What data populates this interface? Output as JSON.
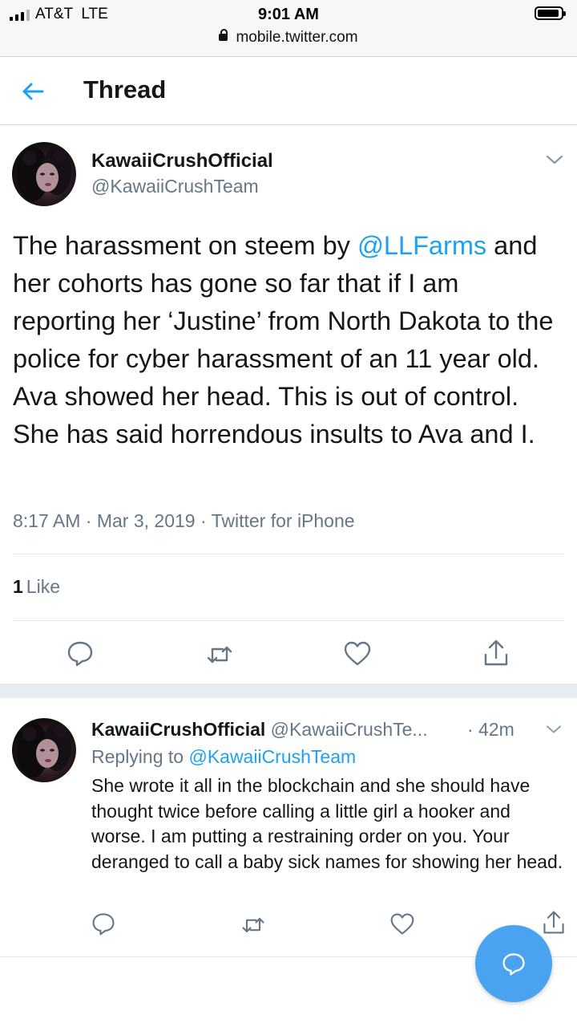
{
  "status_bar": {
    "carrier": "AT&T  LTE",
    "time": "9:01 AM",
    "url": "mobile.twitter.com"
  },
  "header": {
    "title": "Thread"
  },
  "main_tweet": {
    "display_name": "KawaiiCrushOfficial",
    "handle": "@KawaiiCrushTeam",
    "text_before_mention": "The harassment on steem by ",
    "mention": "@LLFarms",
    "text_after_mention": " and her cohorts has gone so far that if I am reporting her ‘Justine’ from North Dakota to the police for cyber harassment of an 11 year old. Ava showed her head. This is out of control.  She has said horrendous insults to Ava and I.",
    "meta": "8:17 AM · Mar 3, 2019 · Twitter for iPhone",
    "like_count": "1",
    "like_label": "Like"
  },
  "reply": {
    "display_name": "KawaiiCrushOfficial",
    "handle": "@KawaiiCrushTe...",
    "time": "· 42m",
    "replying_prefix": "Replying to ",
    "replying_to": "@KawaiiCrushTeam",
    "text": "She wrote it all in the blockchain and she should have thought twice before calling a little girl a hooker and worse. I am putting a restraining order on you. Your deranged to call a baby sick names for showing her head."
  },
  "colors": {
    "accent": "#1da1f2",
    "fab": "#4aa3f0",
    "secondary_text": "#657786"
  },
  "icons": [
    "back-arrow-icon",
    "chevron-down-icon",
    "reply-icon",
    "retweet-icon",
    "like-icon",
    "share-icon",
    "compose-reply-icon",
    "lock-icon",
    "battery-icon",
    "signal-icon"
  ]
}
